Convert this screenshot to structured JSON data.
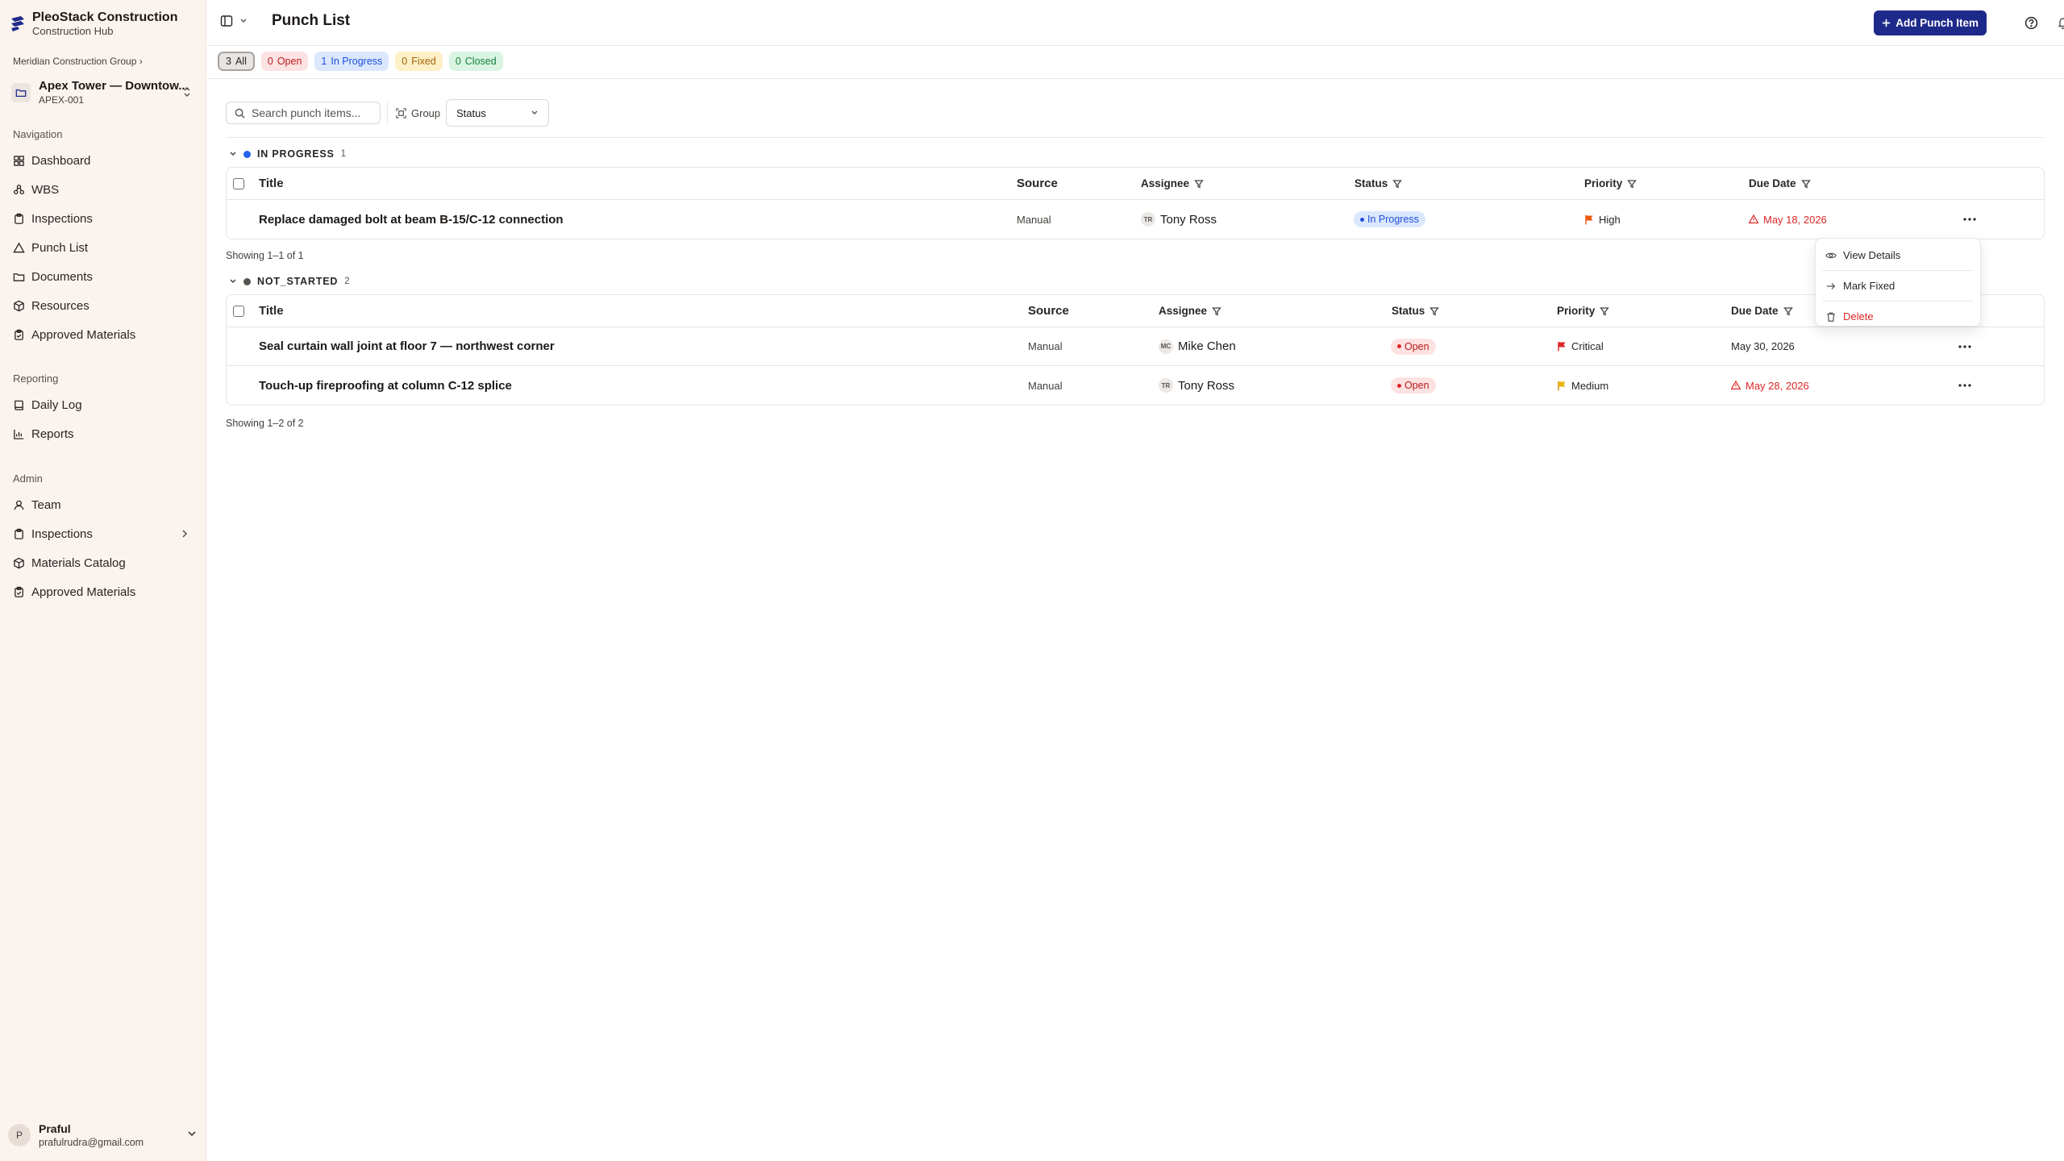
{
  "brand": {
    "title": "PleoStack Construction",
    "subtitle": "Construction Hub"
  },
  "org": {
    "name": "Meridian Construction Group",
    "separator": "›"
  },
  "project": {
    "name": "Apex Tower — Downtow...",
    "code": "APEX-001"
  },
  "sidebar": {
    "navigation_label": "Navigation",
    "navigation": [
      {
        "label": "Dashboard",
        "icon": "dashboard-icon"
      },
      {
        "label": "WBS",
        "icon": "wbs-icon"
      },
      {
        "label": "Inspections",
        "icon": "clipboard-icon"
      },
      {
        "label": "Punch List",
        "icon": "triangle-icon"
      },
      {
        "label": "Documents",
        "icon": "folder-icon"
      },
      {
        "label": "Resources",
        "icon": "box-icon"
      },
      {
        "label": "Approved Materials",
        "icon": "clipboard-check-icon"
      }
    ],
    "reporting_label": "Reporting",
    "reporting": [
      {
        "label": "Daily Log",
        "icon": "book-icon"
      },
      {
        "label": "Reports",
        "icon": "bar-chart-icon"
      }
    ],
    "admin_label": "Admin",
    "admin": [
      {
        "label": "Team",
        "icon": "users-icon"
      },
      {
        "label": "Inspections",
        "icon": "clipboard-icon"
      },
      {
        "label": "Materials Catalog",
        "icon": "box-icon"
      },
      {
        "label": "Approved Materials",
        "icon": "clipboard-check-icon"
      }
    ]
  },
  "user": {
    "initial": "P",
    "name": "Praful",
    "email": "prafulrudra@gmail.com"
  },
  "header": {
    "title": "Punch List",
    "add_label": "Add Punch Item"
  },
  "chips": [
    {
      "count": "3",
      "label": "All"
    },
    {
      "count": "0",
      "label": "Open"
    },
    {
      "count": "1",
      "label": "In Progress"
    },
    {
      "count": "0",
      "label": "Fixed"
    },
    {
      "count": "0",
      "label": "Closed"
    }
  ],
  "toolbar": {
    "search_placeholder": "Search punch items...",
    "group_label": "Group",
    "group_value": "Status"
  },
  "columns": {
    "title": "Title",
    "source": "Source",
    "assignee": "Assignee",
    "status": "Status",
    "priority": "Priority",
    "due_date": "Due Date"
  },
  "groups": [
    {
      "name": "IN PROGRESS",
      "count": "1",
      "dot_color": "#2563eb",
      "showing": "Showing 1–1 of 1",
      "rows": [
        {
          "title": "Replace damaged bolt at beam B-15/C-12 connection",
          "source": "Manual",
          "initials": "TR",
          "assignee": "Tony Ross",
          "status": "In Progress",
          "priority": "High",
          "priority_color": "#ea580c",
          "due": "May 18, 2026",
          "overdue": true
        }
      ]
    },
    {
      "name": "NOT_STARTED",
      "count": "2",
      "dot_color": "#57534e",
      "showing": "Showing 1–2 of 2",
      "rows": [
        {
          "title": "Seal curtain wall joint at floor 7 — northwest corner",
          "source": "Manual",
          "initials": "MC",
          "assignee": "Mike Chen",
          "status": "Open",
          "priority": "Critical",
          "priority_color": "#dc2626",
          "due": "May 30, 2026",
          "overdue": false
        },
        {
          "title": "Touch-up fireproofing at column C-12 splice",
          "source": "Manual",
          "initials": "TR",
          "assignee": "Tony Ross",
          "status": "Open",
          "priority": "Medium",
          "priority_color": "#ca8a04",
          "due": "May 28, 2026",
          "overdue": true
        }
      ]
    }
  ],
  "context_menu": [
    {
      "label": "View Details",
      "icon": "eye-icon"
    },
    {
      "label": "Mark Fixed",
      "icon": "arrow-right-icon"
    },
    {
      "label": "Delete",
      "icon": "trash-icon"
    }
  ],
  "colors": {
    "primary": "#1e2a8a",
    "sidebar_bg": "#fbf3ee",
    "danger": "#dc2626"
  }
}
